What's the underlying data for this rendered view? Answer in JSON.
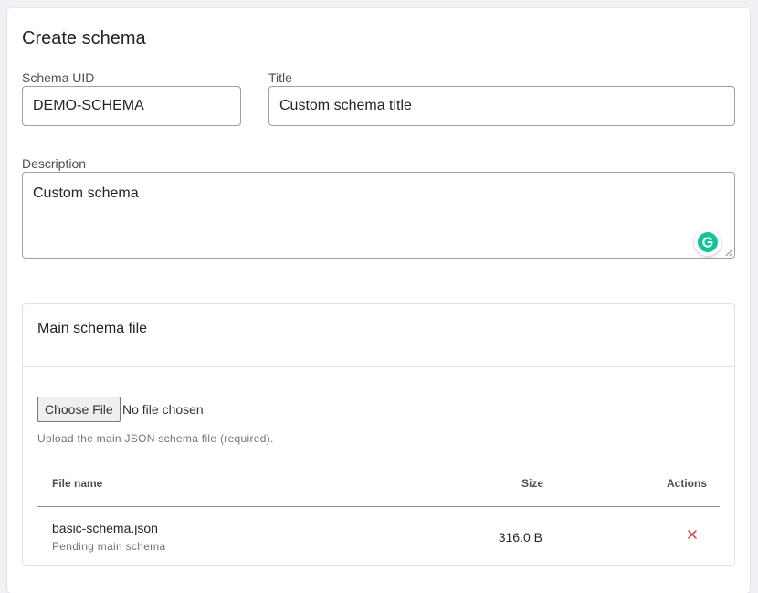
{
  "page": {
    "title": "Create schema"
  },
  "form": {
    "schema_uid": {
      "label": "Schema UID",
      "value": "DEMO-SCHEMA"
    },
    "title": {
      "label": "Title",
      "value": "Custom schema title"
    },
    "description": {
      "label": "Description",
      "value": "Custom schema"
    }
  },
  "main_file": {
    "section_title": "Main schema file",
    "choose_button": "Choose File",
    "no_file_text": "No file chosen",
    "help": "Upload the main JSON schema file (required).",
    "table": {
      "headers": {
        "name": "File name",
        "size": "Size",
        "actions": "Actions"
      },
      "rows": [
        {
          "name": "basic-schema.json",
          "status": "Pending main schema",
          "size": "316.0 B"
        }
      ]
    }
  },
  "icons": {
    "remove": "close-icon",
    "grammarly": "grammarly-icon"
  },
  "colors": {
    "danger": "#dc3545",
    "grammarly": "#15c39a"
  }
}
